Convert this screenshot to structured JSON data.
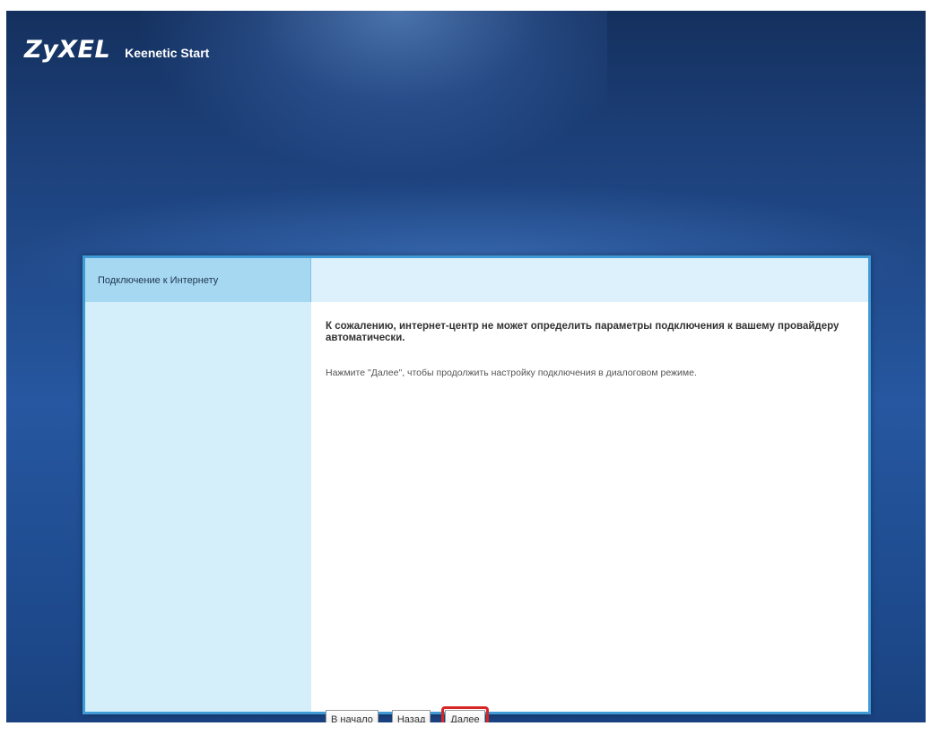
{
  "header": {
    "logo": "ZyXEL",
    "product": "Keenetic Start"
  },
  "panel": {
    "tab_label": "Подключение к Интернету",
    "message": "К сожалению, интернет-центр не может определить параметры подключения к вашему провайдеру автоматически.",
    "hint": "Нажмите \"Далее\", чтобы продолжить настройку подключения в диалоговом режиме.",
    "buttons": {
      "start": "В начало",
      "back": "Назад",
      "next": "Далее"
    }
  },
  "colors": {
    "background": "#2657a0",
    "panel_border": "#3f9ad6",
    "tab_active": "#a7d8f2",
    "highlight": "#d62626"
  }
}
